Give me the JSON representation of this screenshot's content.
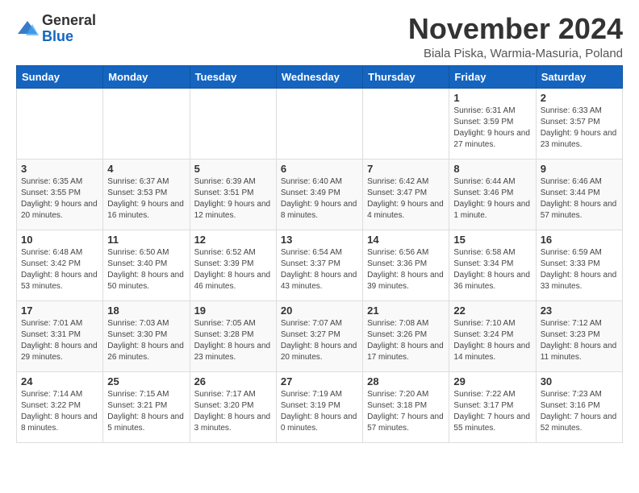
{
  "logo": {
    "general": "General",
    "blue": "Blue"
  },
  "header": {
    "month": "November 2024",
    "location": "Biala Piska, Warmia-Masuria, Poland"
  },
  "weekdays": [
    "Sunday",
    "Monday",
    "Tuesday",
    "Wednesday",
    "Thursday",
    "Friday",
    "Saturday"
  ],
  "weeks": [
    [
      {
        "day": "",
        "info": ""
      },
      {
        "day": "",
        "info": ""
      },
      {
        "day": "",
        "info": ""
      },
      {
        "day": "",
        "info": ""
      },
      {
        "day": "",
        "info": ""
      },
      {
        "day": "1",
        "info": "Sunrise: 6:31 AM\nSunset: 3:59 PM\nDaylight: 9 hours and 27 minutes."
      },
      {
        "day": "2",
        "info": "Sunrise: 6:33 AM\nSunset: 3:57 PM\nDaylight: 9 hours and 23 minutes."
      }
    ],
    [
      {
        "day": "3",
        "info": "Sunrise: 6:35 AM\nSunset: 3:55 PM\nDaylight: 9 hours and 20 minutes."
      },
      {
        "day": "4",
        "info": "Sunrise: 6:37 AM\nSunset: 3:53 PM\nDaylight: 9 hours and 16 minutes."
      },
      {
        "day": "5",
        "info": "Sunrise: 6:39 AM\nSunset: 3:51 PM\nDaylight: 9 hours and 12 minutes."
      },
      {
        "day": "6",
        "info": "Sunrise: 6:40 AM\nSunset: 3:49 PM\nDaylight: 9 hours and 8 minutes."
      },
      {
        "day": "7",
        "info": "Sunrise: 6:42 AM\nSunset: 3:47 PM\nDaylight: 9 hours and 4 minutes."
      },
      {
        "day": "8",
        "info": "Sunrise: 6:44 AM\nSunset: 3:46 PM\nDaylight: 9 hours and 1 minute."
      },
      {
        "day": "9",
        "info": "Sunrise: 6:46 AM\nSunset: 3:44 PM\nDaylight: 8 hours and 57 minutes."
      }
    ],
    [
      {
        "day": "10",
        "info": "Sunrise: 6:48 AM\nSunset: 3:42 PM\nDaylight: 8 hours and 53 minutes."
      },
      {
        "day": "11",
        "info": "Sunrise: 6:50 AM\nSunset: 3:40 PM\nDaylight: 8 hours and 50 minutes."
      },
      {
        "day": "12",
        "info": "Sunrise: 6:52 AM\nSunset: 3:39 PM\nDaylight: 8 hours and 46 minutes."
      },
      {
        "day": "13",
        "info": "Sunrise: 6:54 AM\nSunset: 3:37 PM\nDaylight: 8 hours and 43 minutes."
      },
      {
        "day": "14",
        "info": "Sunrise: 6:56 AM\nSunset: 3:36 PM\nDaylight: 8 hours and 39 minutes."
      },
      {
        "day": "15",
        "info": "Sunrise: 6:58 AM\nSunset: 3:34 PM\nDaylight: 8 hours and 36 minutes."
      },
      {
        "day": "16",
        "info": "Sunrise: 6:59 AM\nSunset: 3:33 PM\nDaylight: 8 hours and 33 minutes."
      }
    ],
    [
      {
        "day": "17",
        "info": "Sunrise: 7:01 AM\nSunset: 3:31 PM\nDaylight: 8 hours and 29 minutes."
      },
      {
        "day": "18",
        "info": "Sunrise: 7:03 AM\nSunset: 3:30 PM\nDaylight: 8 hours and 26 minutes."
      },
      {
        "day": "19",
        "info": "Sunrise: 7:05 AM\nSunset: 3:28 PM\nDaylight: 8 hours and 23 minutes."
      },
      {
        "day": "20",
        "info": "Sunrise: 7:07 AM\nSunset: 3:27 PM\nDaylight: 8 hours and 20 minutes."
      },
      {
        "day": "21",
        "info": "Sunrise: 7:08 AM\nSunset: 3:26 PM\nDaylight: 8 hours and 17 minutes."
      },
      {
        "day": "22",
        "info": "Sunrise: 7:10 AM\nSunset: 3:24 PM\nDaylight: 8 hours and 14 minutes."
      },
      {
        "day": "23",
        "info": "Sunrise: 7:12 AM\nSunset: 3:23 PM\nDaylight: 8 hours and 11 minutes."
      }
    ],
    [
      {
        "day": "24",
        "info": "Sunrise: 7:14 AM\nSunset: 3:22 PM\nDaylight: 8 hours and 8 minutes."
      },
      {
        "day": "25",
        "info": "Sunrise: 7:15 AM\nSunset: 3:21 PM\nDaylight: 8 hours and 5 minutes."
      },
      {
        "day": "26",
        "info": "Sunrise: 7:17 AM\nSunset: 3:20 PM\nDaylight: 8 hours and 3 minutes."
      },
      {
        "day": "27",
        "info": "Sunrise: 7:19 AM\nSunset: 3:19 PM\nDaylight: 8 hours and 0 minutes."
      },
      {
        "day": "28",
        "info": "Sunrise: 7:20 AM\nSunset: 3:18 PM\nDaylight: 7 hours and 57 minutes."
      },
      {
        "day": "29",
        "info": "Sunrise: 7:22 AM\nSunset: 3:17 PM\nDaylight: 7 hours and 55 minutes."
      },
      {
        "day": "30",
        "info": "Sunrise: 7:23 AM\nSunset: 3:16 PM\nDaylight: 7 hours and 52 minutes."
      }
    ]
  ]
}
